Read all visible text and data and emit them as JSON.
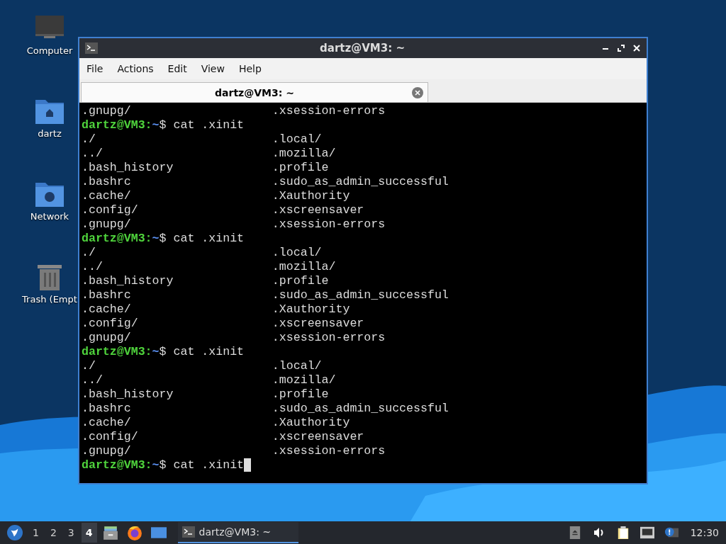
{
  "desktop_icons": [
    {
      "label": "Computer",
      "kind": "computer"
    },
    {
      "label": "dartz",
      "kind": "home"
    },
    {
      "label": "Network",
      "kind": "network"
    },
    {
      "label": "Trash (Empt",
      "kind": "trash"
    }
  ],
  "window": {
    "title": "dartz@VM3: ~",
    "menu": [
      "File",
      "Actions",
      "Edit",
      "View",
      "Help"
    ],
    "tabs": [
      {
        "label": "dartz@VM3: ~",
        "selected": true
      }
    ],
    "terminal": [
      {
        "kind": "listing",
        "col1": ".gnupg/",
        "col2": ".xsession-errors"
      },
      {
        "kind": "prompt",
        "user": "dartz@VM3:",
        "path": "~",
        "command": "$ cat .xinit",
        "cursor": false
      },
      {
        "kind": "listing",
        "col1": "./",
        "col2": ".local/"
      },
      {
        "kind": "listing",
        "col1": "../",
        "col2": ".mozilla/"
      },
      {
        "kind": "listing",
        "col1": ".bash_history",
        "col2": ".profile"
      },
      {
        "kind": "listing",
        "col1": ".bashrc",
        "col2": ".sudo_as_admin_successful"
      },
      {
        "kind": "listing",
        "col1": ".cache/",
        "col2": ".Xauthority"
      },
      {
        "kind": "listing",
        "col1": ".config/",
        "col2": ".xscreensaver"
      },
      {
        "kind": "listing",
        "col1": ".gnupg/",
        "col2": ".xsession-errors"
      },
      {
        "kind": "prompt",
        "user": "dartz@VM3:",
        "path": "~",
        "command": "$ cat .xinit",
        "cursor": false
      },
      {
        "kind": "listing",
        "col1": "./",
        "col2": ".local/"
      },
      {
        "kind": "listing",
        "col1": "../",
        "col2": ".mozilla/"
      },
      {
        "kind": "listing",
        "col1": ".bash_history",
        "col2": ".profile"
      },
      {
        "kind": "listing",
        "col1": ".bashrc",
        "col2": ".sudo_as_admin_successful"
      },
      {
        "kind": "listing",
        "col1": ".cache/",
        "col2": ".Xauthority"
      },
      {
        "kind": "listing",
        "col1": ".config/",
        "col2": ".xscreensaver"
      },
      {
        "kind": "listing",
        "col1": ".gnupg/",
        "col2": ".xsession-errors"
      },
      {
        "kind": "prompt",
        "user": "dartz@VM3:",
        "path": "~",
        "command": "$ cat .xinit",
        "cursor": false
      },
      {
        "kind": "listing",
        "col1": "./",
        "col2": ".local/"
      },
      {
        "kind": "listing",
        "col1": "../",
        "col2": ".mozilla/"
      },
      {
        "kind": "listing",
        "col1": ".bash_history",
        "col2": ".profile"
      },
      {
        "kind": "listing",
        "col1": ".bashrc",
        "col2": ".sudo_as_admin_successful"
      },
      {
        "kind": "listing",
        "col1": ".cache/",
        "col2": ".Xauthority"
      },
      {
        "kind": "listing",
        "col1": ".config/",
        "col2": ".xscreensaver"
      },
      {
        "kind": "listing",
        "col1": ".gnupg/",
        "col2": ".xsession-errors"
      },
      {
        "kind": "prompt",
        "user": "dartz@VM3:",
        "path": "~",
        "command": "$ cat .xinit",
        "cursor": true
      }
    ]
  },
  "taskbar": {
    "workspaces": [
      {
        "label": "1",
        "selected": false
      },
      {
        "label": "2",
        "selected": false
      },
      {
        "label": "3",
        "selected": false
      },
      {
        "label": "4",
        "selected": true
      }
    ],
    "tasks": [
      {
        "label": "dartz@VM3: ~",
        "selected": true
      }
    ],
    "clock": "12:30"
  }
}
